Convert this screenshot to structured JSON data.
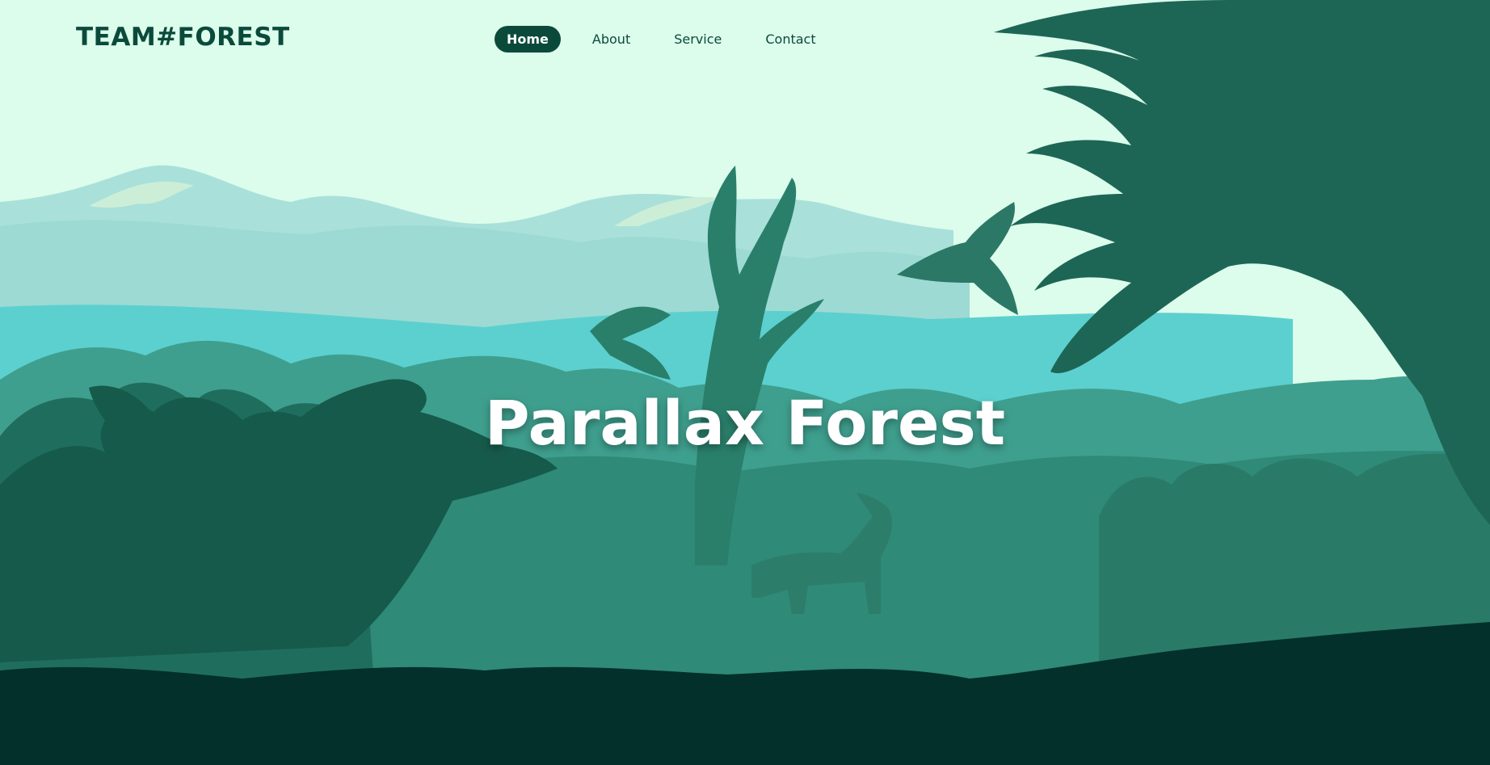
{
  "brand": {
    "logo_text": "TEAM#FOREST"
  },
  "nav": {
    "items": [
      {
        "label": "Home",
        "active": true
      },
      {
        "label": "About",
        "active": false
      },
      {
        "label": "Service",
        "active": false
      },
      {
        "label": "Contact",
        "active": false
      }
    ]
  },
  "hero": {
    "title": "Parallax Forest"
  },
  "colors": {
    "sky": "#dcfcec",
    "brand_dark": "#0b4a3a",
    "ground": "#03302a",
    "mountain_light": "#a8e2da",
    "lake": "#5ccfcf"
  }
}
